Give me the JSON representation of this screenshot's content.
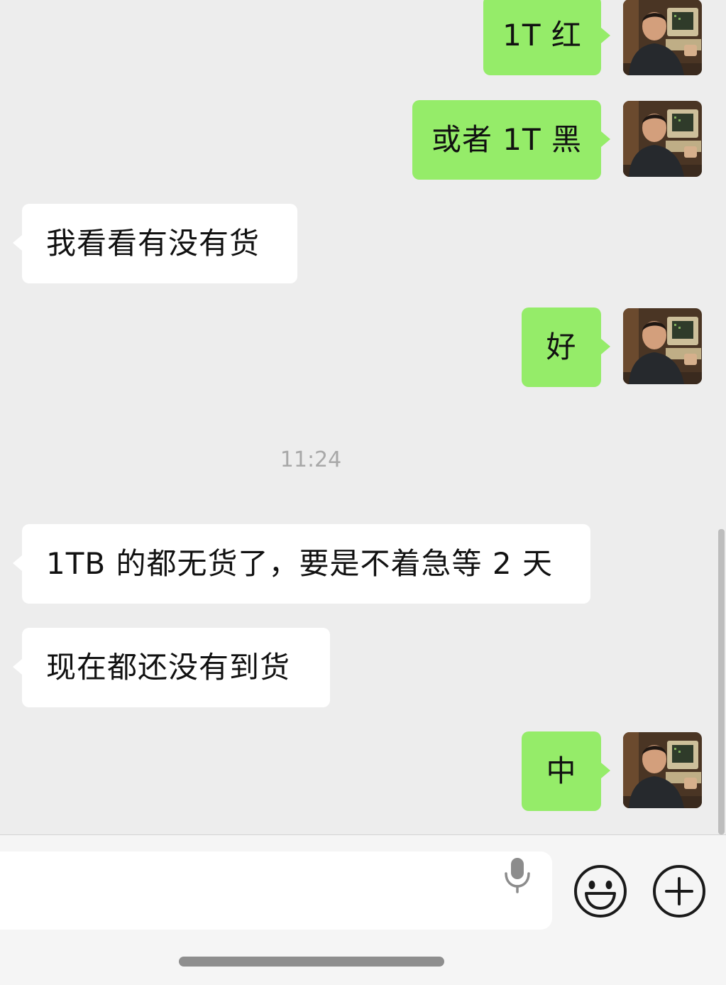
{
  "messages": [
    {
      "side": "out",
      "text": "1T 红"
    },
    {
      "side": "out",
      "text": "或者 1T 黑"
    },
    {
      "side": "in",
      "text": "我看看有没有货"
    },
    {
      "side": "out",
      "text": "好"
    },
    {
      "side": "in",
      "text": "1TB 的都无货了，要是不着急等 2 天"
    },
    {
      "side": "in",
      "text": "现在都还没有到货"
    },
    {
      "side": "out",
      "text": "中"
    }
  ],
  "timestamp": "11:24",
  "composer": {
    "input_value": "",
    "voice_icon": "microphone-icon",
    "emoji_icon": "smiley-face-icon",
    "more_icon": "plus-circle-icon"
  },
  "colors": {
    "background": "#ededed",
    "outgoing_bubble": "#95ec69",
    "incoming_bubble": "#ffffff",
    "timestamp": "#a8a8a8"
  }
}
